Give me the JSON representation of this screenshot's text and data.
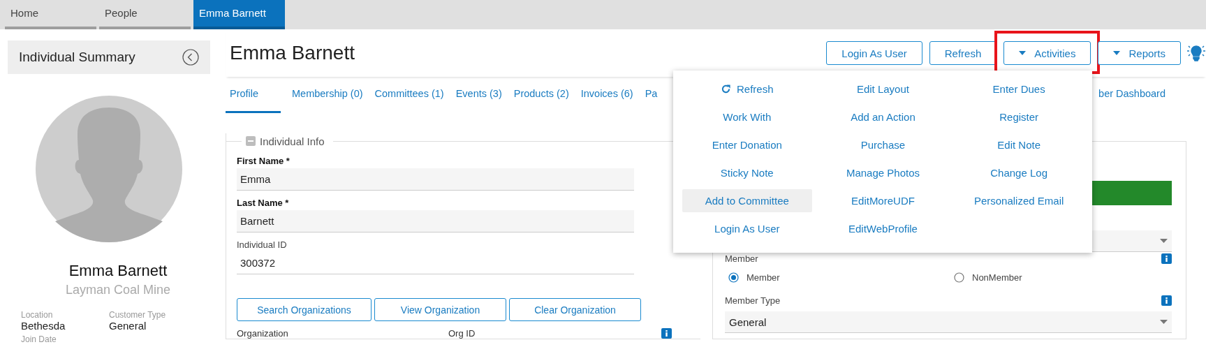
{
  "top_tabs": [
    {
      "label": "Home",
      "selected": false
    },
    {
      "label": "People",
      "selected": false
    },
    {
      "label": "Emma Barnett",
      "selected": true
    }
  ],
  "sidebar": {
    "title": "Individual Summary",
    "name": "Emma Barnett",
    "organization": "Layman Coal Mine",
    "details": [
      {
        "label": "Location",
        "value": "Bethesda"
      },
      {
        "label": "Customer Type",
        "value": "General"
      },
      {
        "label": "Join Date"
      }
    ]
  },
  "header": {
    "title": "Emma Barnett",
    "buttons": [
      {
        "label": "Login As User",
        "kind": "plain"
      },
      {
        "label": "Refresh",
        "kind": "plain"
      },
      {
        "label": "Activities",
        "kind": "dropdown",
        "expanded": true,
        "highlighted": true
      },
      {
        "label": "Reports",
        "kind": "dropdown"
      }
    ]
  },
  "profile_tabs": [
    {
      "label": "Profile",
      "selected": true
    },
    {
      "label": "Membership (0)",
      "selected": false
    },
    {
      "label": "Committees (1)",
      "selected": false
    },
    {
      "label": "Events (3)",
      "selected": false
    },
    {
      "label": "Products (2)",
      "selected": false
    },
    {
      "label": "Invoices (6)",
      "selected": false
    },
    {
      "label": "Pa",
      "selected": false
    },
    {
      "label": "ber Dashboard",
      "selected": false
    }
  ],
  "activities_menu": [
    {
      "label": "Refresh",
      "kind": "refresh",
      "selected": false
    },
    {
      "label": "Edit Layout",
      "kind": "plain",
      "selected": false
    },
    {
      "label": "Enter Dues",
      "kind": "plain",
      "selected": false
    },
    {
      "label": "Work With",
      "kind": "plain",
      "selected": false
    },
    {
      "label": "Add an Action",
      "kind": "plain",
      "selected": false
    },
    {
      "label": "Register",
      "kind": "plain",
      "selected": false
    },
    {
      "label": "Enter Donation",
      "kind": "plain",
      "selected": false
    },
    {
      "label": "Purchase",
      "kind": "plain",
      "selected": false
    },
    {
      "label": "Edit Note",
      "kind": "plain",
      "selected": false
    },
    {
      "label": "Sticky Note",
      "kind": "plain",
      "selected": false
    },
    {
      "label": "Manage Photos",
      "kind": "plain",
      "selected": false
    },
    {
      "label": "Change Log",
      "kind": "plain",
      "selected": false
    },
    {
      "label": "Add to Committee",
      "kind": "plain",
      "selected": true
    },
    {
      "label": "EditMoreUDF",
      "kind": "plain",
      "selected": false
    },
    {
      "label": "Personalized Email",
      "kind": "plain",
      "selected": false
    },
    {
      "label": "Login As User",
      "kind": "plain",
      "selected": false
    },
    {
      "label": "EditWebProfile",
      "kind": "plain",
      "selected": false
    }
  ],
  "individual_info": {
    "title": "Individual Info",
    "expanded": true,
    "fields": [
      {
        "label": "First Name *",
        "kind": "input",
        "value": "Emma"
      },
      {
        "label": "Last Name *",
        "kind": "input",
        "value": "Barnett"
      },
      {
        "label": "Individual ID",
        "kind": "readonly",
        "value": "300372"
      }
    ],
    "buttons": [
      "Search Organizations",
      "View Organization",
      "Clear Organization"
    ],
    "columns": [
      "Organization",
      "Org ID"
    ]
  },
  "membership": {
    "member_label": "Member",
    "options": [
      {
        "label": "Member",
        "selected": true
      },
      {
        "label": "NonMember",
        "selected": false
      }
    ],
    "member_type_label": "Member Type",
    "member_type": "General"
  }
}
